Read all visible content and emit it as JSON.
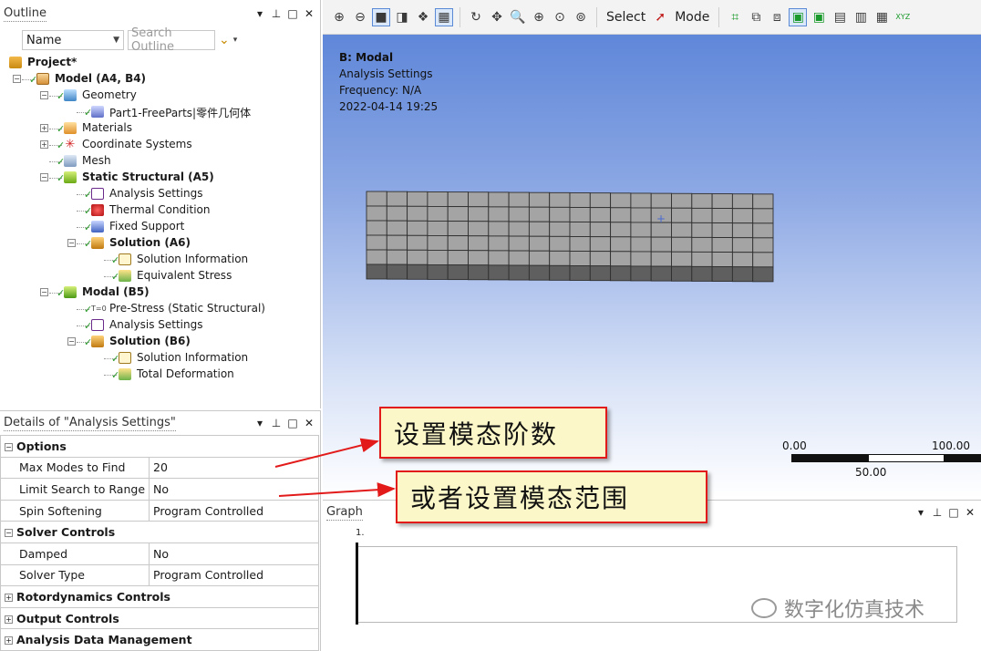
{
  "outline": {
    "title": "Outline",
    "controls": [
      "▾",
      "ᵖ",
      "□",
      "✕"
    ],
    "name_filter": "Name",
    "search_placeholder": "Search Outline",
    "tree": [
      {
        "label": "Project*",
        "bold": true,
        "icon": "project-icon",
        "level": 0,
        "expander": ""
      },
      {
        "label": "Model (A4, B4)",
        "bold": true,
        "icon": "model-icon",
        "level": 1,
        "expander": "−"
      },
      {
        "label": "Geometry",
        "bold": false,
        "icon": "geometry-icon",
        "level": 2,
        "expander": "−"
      },
      {
        "label": "Part1-FreeParts|零件几何体",
        "bold": false,
        "icon": "part-icon",
        "level": 3,
        "expander": ""
      },
      {
        "label": "Materials",
        "bold": false,
        "icon": "materials-icon",
        "level": 2,
        "expander": "+"
      },
      {
        "label": "Coordinate Systems",
        "bold": false,
        "icon": "coordinate-systems-icon",
        "level": 2,
        "expander": "+"
      },
      {
        "label": "Mesh",
        "bold": false,
        "icon": "mesh-icon",
        "level": 2,
        "expander": ""
      },
      {
        "label": "Static Structural (A5)",
        "bold": true,
        "icon": "static-structural-icon",
        "level": 2,
        "expander": "−"
      },
      {
        "label": "Analysis Settings",
        "bold": false,
        "icon": "analysis-settings-icon",
        "level": 3,
        "expander": ""
      },
      {
        "label": "Thermal Condition",
        "bold": false,
        "icon": "thermal-condition-icon",
        "level": 3,
        "expander": ""
      },
      {
        "label": "Fixed Support",
        "bold": false,
        "icon": "fixed-support-icon",
        "level": 3,
        "expander": ""
      },
      {
        "label": "Solution (A6)",
        "bold": true,
        "icon": "solution-icon",
        "level": 3,
        "expander": "−"
      },
      {
        "label": "Solution Information",
        "bold": false,
        "icon": "solution-information-icon",
        "level": 4,
        "expander": ""
      },
      {
        "label": "Equivalent Stress",
        "bold": false,
        "icon": "equivalent-stress-icon",
        "level": 4,
        "expander": ""
      },
      {
        "label": "Modal (B5)",
        "bold": true,
        "icon": "modal-icon",
        "level": 2,
        "expander": "−"
      },
      {
        "label": "Pre-Stress (Static Structural)",
        "bold": false,
        "icon": "pre-stress-icon",
        "level": 3,
        "expander": ""
      },
      {
        "label": "Analysis Settings",
        "bold": false,
        "icon": "analysis-settings-icon",
        "level": 3,
        "expander": ""
      },
      {
        "label": "Solution (B6)",
        "bold": true,
        "icon": "solution-icon",
        "level": 3,
        "expander": "−"
      },
      {
        "label": "Solution Information",
        "bold": false,
        "icon": "solution-information-icon",
        "level": 4,
        "expander": ""
      },
      {
        "label": "Total Deformation",
        "bold": false,
        "icon": "total-deformation-icon",
        "level": 4,
        "expander": ""
      }
    ]
  },
  "details": {
    "title": "Details of \"Analysis Settings\"",
    "controls": [
      "▾",
      "ᵖ",
      "□",
      "✕"
    ],
    "rows": [
      {
        "type": "group",
        "label": "Options",
        "expander": "−"
      },
      {
        "type": "prop",
        "name": "Max Modes to Find",
        "value": "20"
      },
      {
        "type": "prop",
        "name": "Limit Search to Range",
        "value": "No"
      },
      {
        "type": "prop",
        "name": "Spin Softening",
        "value": "Program Controlled"
      },
      {
        "type": "group",
        "label": "Solver Controls",
        "expander": "−"
      },
      {
        "type": "prop",
        "name": "Damped",
        "value": "No"
      },
      {
        "type": "prop",
        "name": "Solver Type",
        "value": "Program Controlled"
      },
      {
        "type": "group",
        "label": "Rotordynamics Controls",
        "expander": "+"
      },
      {
        "type": "group",
        "label": "Output Controls",
        "expander": "+"
      },
      {
        "type": "group",
        "label": "Analysis Data Management",
        "expander": "+"
      }
    ]
  },
  "toolbar": {
    "select_label": "Select",
    "mode_label": "Mode",
    "xyz_label": "XYZ"
  },
  "viewport": {
    "title": "B: Modal",
    "subtitle": "Analysis Settings",
    "frequency": "Frequency: N/A",
    "timestamp": "2022-04-14 19:25",
    "scale": {
      "left": "0.00",
      "right": "100.00",
      "mid": "50.00"
    },
    "background_top": "#5f87d9",
    "background_bottom": "#ffffff"
  },
  "graph": {
    "title": "Graph",
    "controls": [
      "▾",
      "ᵖ",
      "□",
      "✕"
    ],
    "tick_label": "1."
  },
  "annotations": {
    "callout1": "设置模态阶数",
    "callout2": "或者设置模态范围",
    "border_color": "#e21a1a",
    "fill_color": "#fcf7c8"
  },
  "watermark": {
    "text": "数字化仿真技术"
  }
}
